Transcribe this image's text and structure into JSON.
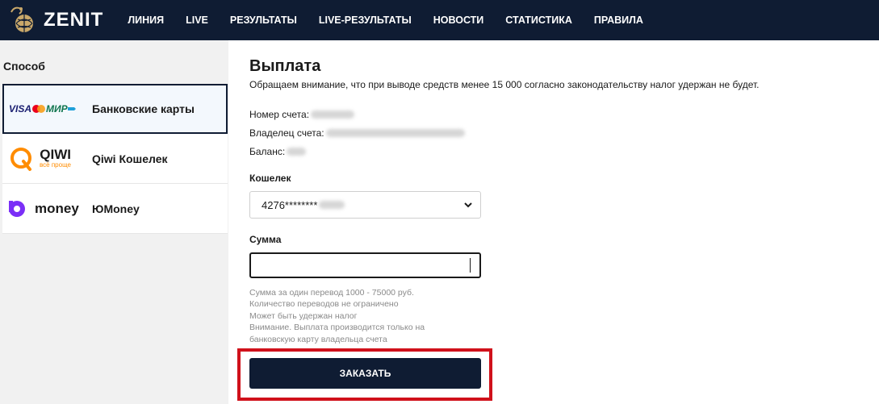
{
  "header": {
    "brand": "ZENIT",
    "nav": [
      "ЛИНИЯ",
      "LIVE",
      "РЕЗУЛЬТАТЫ",
      "LIVE-РЕЗУЛЬТАТЫ",
      "НОВОСТИ",
      "СТАТИСТИКА",
      "ПРАВИЛА"
    ]
  },
  "sidebar": {
    "title": "Способ",
    "methods": [
      {
        "label": "Банковские карты",
        "logo_visa": "VISA",
        "logo_mir": "МИР",
        "active": true
      },
      {
        "label": "Qiwi Кошелек",
        "logo_main": "QIWI",
        "logo_sub": "всё проще",
        "active": false
      },
      {
        "label": "ЮMoney",
        "logo_main": "money",
        "active": false
      }
    ]
  },
  "main": {
    "title": "Выплата",
    "notice": "Обращаем внимание, что при выводе средств менее 15 000 согласно законодательству налог удержан не будет.",
    "account_label": "Номер счета:",
    "owner_label": "Владелец счета:",
    "balance_label": "Баланс:",
    "wallet_label": "Кошелек",
    "wallet_value": "4276********",
    "amount_label": "Сумма",
    "amount_value": "",
    "hints": [
      "Сумма за один перевод 1000 - 75000 руб.",
      "Количество переводов не ограничено",
      "Может быть удержан налог",
      "Внимание. Выплата производится только на банковскую карту владельца счета"
    ],
    "submit_label": "ЗАКАЗАТЬ"
  },
  "colors": {
    "header_bg": "#0f1c33",
    "button_bg": "#0f1c33",
    "highlight": "#d0111b",
    "qiwi_orange": "#ff8c00",
    "yoomoney_purple": "#7b2ff7"
  }
}
